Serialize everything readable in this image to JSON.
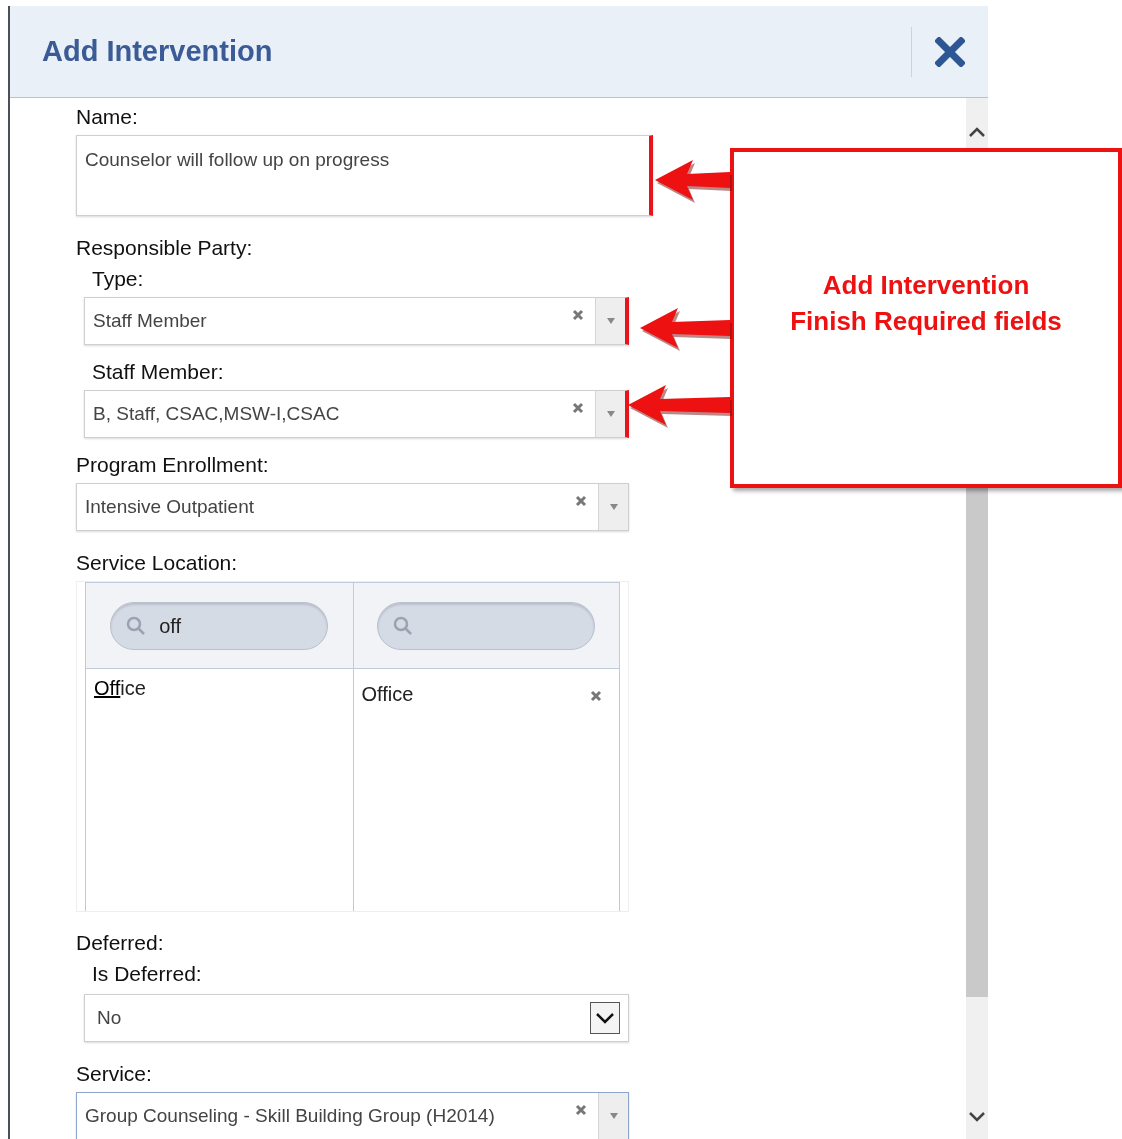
{
  "dialog": {
    "title": "Add Intervention"
  },
  "form": [
    {
      "kind": "textarea",
      "label": "Name:",
      "value": "Counselor will follow up on progress",
      "required": true
    },
    {
      "kind": "group",
      "label": "Responsible Party:",
      "children": [
        {
          "kind": "combo",
          "label": "Type:",
          "value": "Staff Member",
          "required": true
        },
        {
          "kind": "combo",
          "label": "Staff Member:",
          "value": "B, Staff, CSAC,MSW-I,CSAC",
          "required": true
        }
      ]
    },
    {
      "kind": "combo",
      "label": "Program Enrollment:",
      "value": "Intensive Outpatient",
      "required": false
    },
    {
      "kind": "picker",
      "label": "Service Location:",
      "available": {
        "search": "off",
        "items": [
          {
            "parts": [
              {
                "text": "Off",
                "highlighted": true
              },
              {
                "text": "ice",
                "highlighted": false
              }
            ]
          }
        ]
      },
      "chosen": {
        "items": [
          "Office"
        ]
      }
    },
    {
      "kind": "group",
      "label": "Deferred:",
      "children": [
        {
          "kind": "select",
          "label": "Is Deferred:",
          "value": "No"
        }
      ]
    },
    {
      "kind": "combo",
      "label": "Service:",
      "value": "Group Counseling - Skill Building Group (H2014)",
      "required": false,
      "focused": true
    }
  ],
  "callout": {
    "lines": [
      "Add Intervention",
      "Finish Required fields"
    ]
  }
}
